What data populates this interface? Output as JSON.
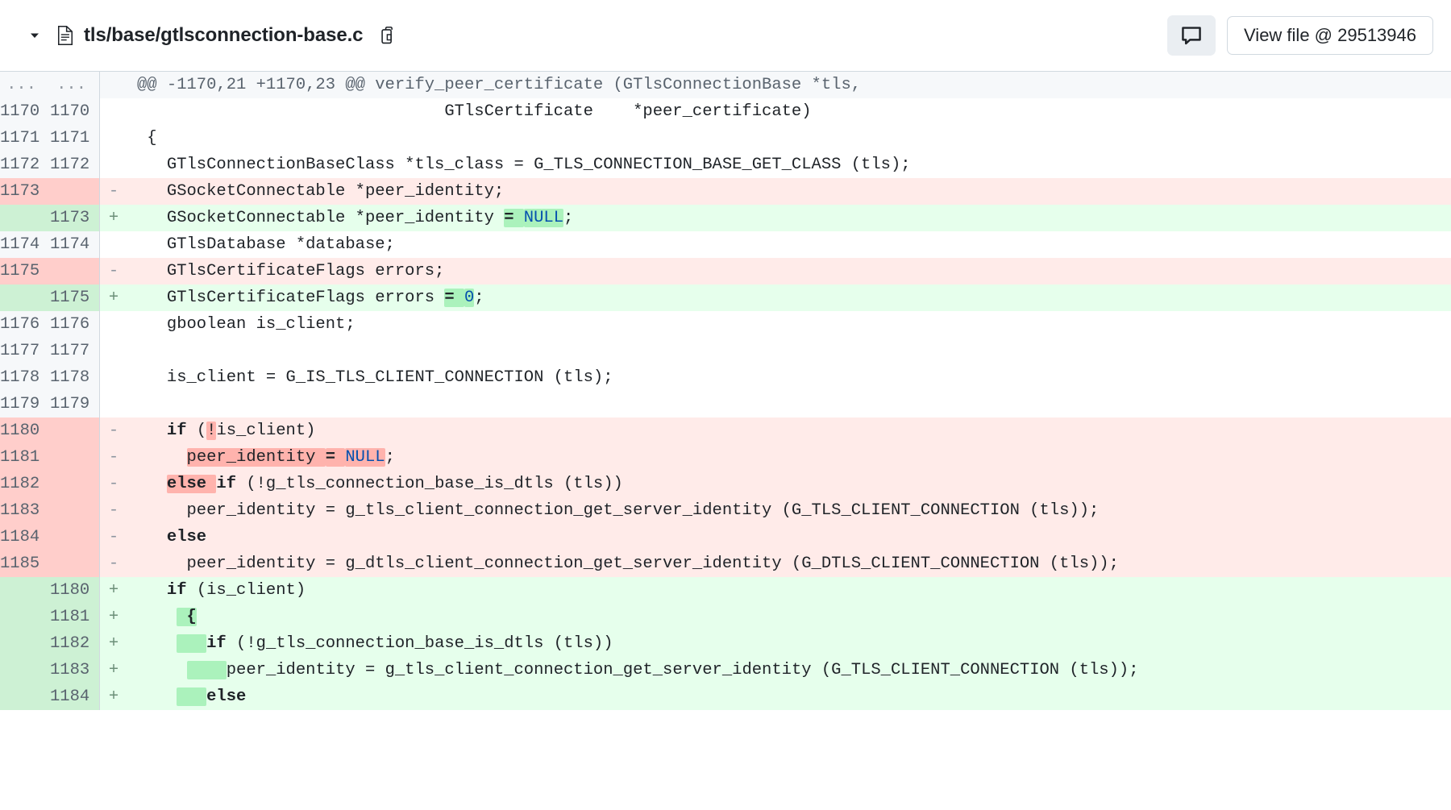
{
  "header": {
    "chevron_icon": "chevron-down-icon",
    "file_icon": "file-icon",
    "file_path": "tls/base/gtlsconnection-base.c",
    "copy_icon": "copy-icon",
    "comment_icon": "comment-icon",
    "view_file_label": "View file @ 29513946"
  },
  "diff": {
    "hunk": {
      "old_ln": "...",
      "new_ln": "...",
      "text": "@@ -1170,21 +1170,23 @@ verify_peer_certificate (GTlsConnectionBase *tls,"
    },
    "rows": [
      {
        "type": "ctx",
        "old_ln": "1170",
        "new_ln": "1170",
        "marker": "",
        "code": "                               GTlsCertificate    *peer_certificate)"
      },
      {
        "type": "ctx",
        "old_ln": "1171",
        "new_ln": "1171",
        "marker": "",
        "code": " {"
      },
      {
        "type": "ctx",
        "old_ln": "1172",
        "new_ln": "1172",
        "marker": "",
        "code": "   GTlsConnectionBaseClass *tls_class = G_TLS_CONNECTION_BASE_GET_CLASS (tls);"
      },
      {
        "type": "del",
        "old_ln": "1173",
        "new_ln": "",
        "marker": "-",
        "code": "   GSocketConnectable *peer_identity;"
      },
      {
        "type": "add",
        "old_ln": "",
        "new_ln": "1173",
        "marker": "+",
        "code": "   GSocketConnectable *peer_identity = NULL;",
        "parts": [
          {
            "t": "   GSocketConnectable *peer_identity "
          },
          {
            "t": "= ",
            "hl": "add",
            "b": true
          },
          {
            "t": "NULL",
            "hl": "add",
            "cls": "const"
          },
          {
            "t": ";"
          }
        ]
      },
      {
        "type": "ctx",
        "old_ln": "1174",
        "new_ln": "1174",
        "marker": "",
        "code": "   GTlsDatabase *database;"
      },
      {
        "type": "del",
        "old_ln": "1175",
        "new_ln": "",
        "marker": "-",
        "code": "   GTlsCertificateFlags errors;"
      },
      {
        "type": "add",
        "old_ln": "",
        "new_ln": "1175",
        "marker": "+",
        "code": "   GTlsCertificateFlags errors = 0;",
        "parts": [
          {
            "t": "   GTlsCertificateFlags errors "
          },
          {
            "t": "= ",
            "hl": "add",
            "b": true
          },
          {
            "t": "0",
            "hl": "add",
            "cls": "const"
          },
          {
            "t": ";"
          }
        ]
      },
      {
        "type": "ctx",
        "old_ln": "1176",
        "new_ln": "1176",
        "marker": "",
        "code": "   gboolean is_client;"
      },
      {
        "type": "ctx",
        "old_ln": "1177",
        "new_ln": "1177",
        "marker": "",
        "code": ""
      },
      {
        "type": "ctx",
        "old_ln": "1178",
        "new_ln": "1178",
        "marker": "",
        "code": "   is_client = G_IS_TLS_CLIENT_CONNECTION (tls);"
      },
      {
        "type": "ctx",
        "old_ln": "1179",
        "new_ln": "1179",
        "marker": "",
        "code": ""
      },
      {
        "type": "del",
        "old_ln": "1180",
        "new_ln": "",
        "marker": "-",
        "code": "   if (!is_client)",
        "parts": [
          {
            "t": "   "
          },
          {
            "t": "if",
            "b": true
          },
          {
            "t": " ("
          },
          {
            "t": "!",
            "hl": "del"
          },
          {
            "t": "is_client)"
          }
        ]
      },
      {
        "type": "del",
        "old_ln": "1181",
        "new_ln": "",
        "marker": "-",
        "code": "     peer_identity = NULL;",
        "parts": [
          {
            "t": "     "
          },
          {
            "t": "peer_identity ",
            "hl": "del"
          },
          {
            "t": "= ",
            "hl": "del",
            "b": true
          },
          {
            "t": "NULL",
            "hl": "del",
            "cls": "const"
          },
          {
            "t": ";"
          }
        ]
      },
      {
        "type": "del",
        "old_ln": "1182",
        "new_ln": "",
        "marker": "-",
        "code": "   else if (!g_tls_connection_base_is_dtls (tls))",
        "parts": [
          {
            "t": "   "
          },
          {
            "t": "else ",
            "hl": "del",
            "b": true
          },
          {
            "t": "if",
            "b": true
          },
          {
            "t": " (!g_tls_connection_base_is_dtls (tls))"
          }
        ]
      },
      {
        "type": "del",
        "old_ln": "1183",
        "new_ln": "",
        "marker": "-",
        "code": "     peer_identity = g_tls_client_connection_get_server_identity (G_TLS_CLIENT_CONNECTION (tls));"
      },
      {
        "type": "del",
        "old_ln": "1184",
        "new_ln": "",
        "marker": "-",
        "code": "   else",
        "parts": [
          {
            "t": "   "
          },
          {
            "t": "else",
            "b": true
          }
        ]
      },
      {
        "type": "del",
        "old_ln": "1185",
        "new_ln": "",
        "marker": "-",
        "code": "     peer_identity = g_dtls_client_connection_get_server_identity (G_DTLS_CLIENT_CONNECTION (tls));"
      },
      {
        "type": "add",
        "old_ln": "",
        "new_ln": "1180",
        "marker": "+",
        "code": "   if (is_client)",
        "parts": [
          {
            "t": "   "
          },
          {
            "t": "if",
            "b": true
          },
          {
            "t": " (is_client)"
          }
        ]
      },
      {
        "type": "add",
        "old_ln": "",
        "new_ln": "1181",
        "marker": "+",
        "code": "     {",
        "parts": [
          {
            "t": "    "
          },
          {
            "t": " {",
            "hl": "add",
            "b": true
          }
        ]
      },
      {
        "type": "add",
        "old_ln": "",
        "new_ln": "1182",
        "marker": "+",
        "code": "       if (!g_tls_connection_base_is_dtls (tls))",
        "parts": [
          {
            "t": "    "
          },
          {
            "t": "   ",
            "hl": "add"
          },
          {
            "t": "if",
            "b": true
          },
          {
            "t": " (!g_tls_connection_base_is_dtls (tls))"
          }
        ]
      },
      {
        "type": "add",
        "old_ln": "",
        "new_ln": "1183",
        "marker": "+",
        "code": "         peer_identity = g_tls_client_connection_get_server_identity (G_TLS_CLIENT_CONNECTION (tls));",
        "parts": [
          {
            "t": "     "
          },
          {
            "t": "    ",
            "hl": "add"
          },
          {
            "t": "peer_identity = g_tls_client_connection_get_server_identity (G_TLS_CLIENT_CONNECTION (tls));"
          }
        ]
      },
      {
        "type": "add",
        "old_ln": "",
        "new_ln": "1184",
        "marker": "+",
        "code": "       else",
        "parts": [
          {
            "t": "    "
          },
          {
            "t": "   ",
            "hl": "add"
          },
          {
            "t": "else",
            "b": true
          }
        ]
      }
    ]
  },
  "colors": {
    "add_bg": "#e6ffec",
    "add_gutter": "#cdf1d4",
    "add_word": "#abf2bc",
    "del_bg": "#ffebe9",
    "del_gutter": "#ffcecb",
    "del_word": "#ffb3ad",
    "context_gutter": "#f6f8fa",
    "border": "#d1d9e0",
    "text": "#1f2328",
    "muted": "#59636e",
    "constant": "#0550ae"
  }
}
